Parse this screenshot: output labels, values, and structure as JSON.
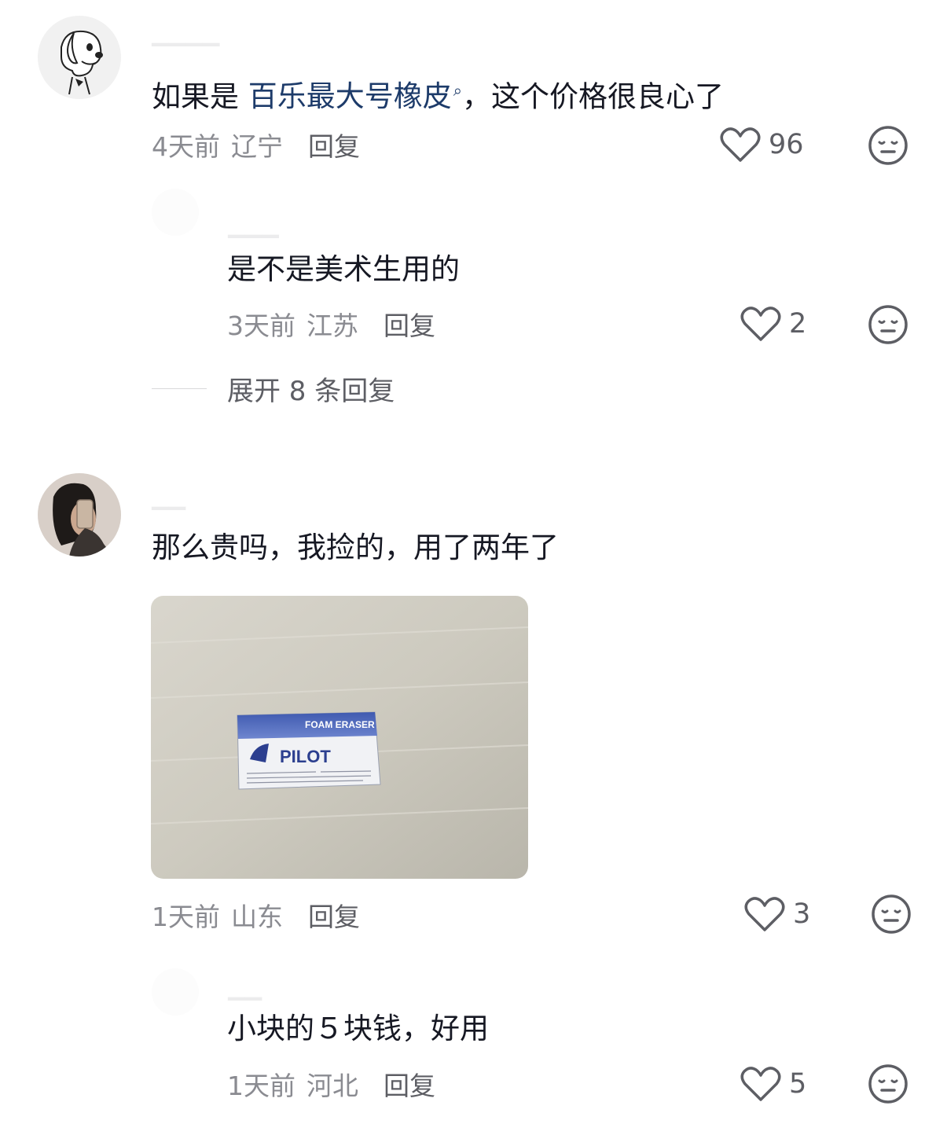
{
  "comments": [
    {
      "text_before": "如果是 ",
      "highlight": "百乐最大号橡皮",
      "search_mark": "⌕",
      "text_after": "，这个价格很良心了",
      "time": "4天前",
      "location": "辽宁",
      "reply_label": "回复",
      "likes": "96",
      "avatar_icon": "snoopy-avatar-icon"
    },
    {
      "text": "是不是美术生用的",
      "time": "3天前",
      "location": "江苏",
      "reply_label": "回复",
      "likes": "2"
    },
    {
      "expand_label": "展开 8 条回复"
    },
    {
      "text": "那么贵吗，我捡的，用了两年了",
      "time": "1天前",
      "location": "山东",
      "reply_label": "回复",
      "likes": "3",
      "photo": {
        "brand": "PILOT",
        "product": "FOAM ERASER"
      }
    },
    {
      "text": "小块的５块钱，好用",
      "time": "1天前",
      "location": "河北",
      "reply_label": "回复",
      "likes": "5"
    }
  ],
  "colors": {
    "highlight": "#1d3b6a",
    "meta": "#8a8b91",
    "text": "#161823"
  }
}
